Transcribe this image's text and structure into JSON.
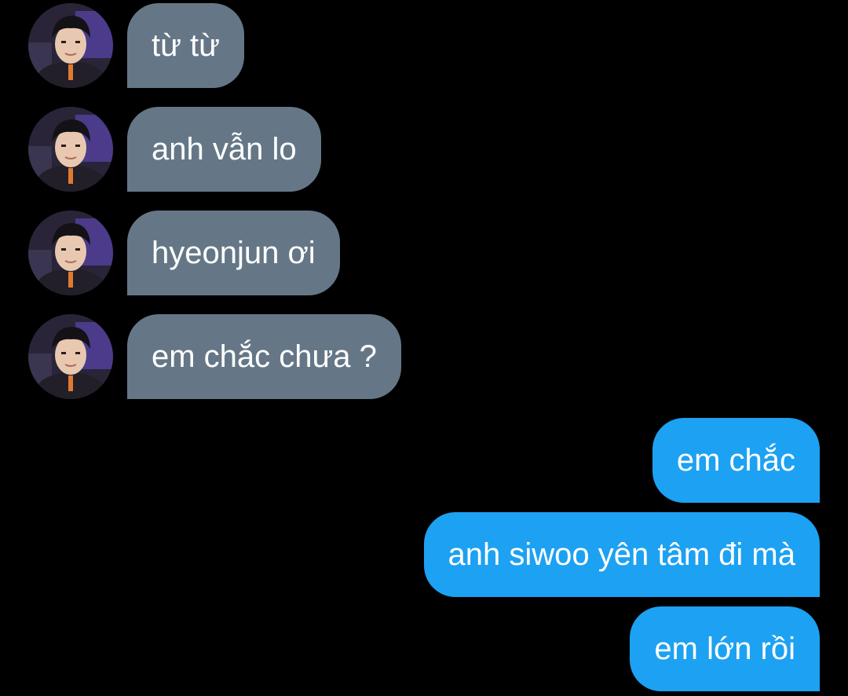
{
  "conversation": {
    "incoming": [
      {
        "text": "từ từ",
        "avatar": "contact-avatar"
      },
      {
        "text": "anh vẫn lo",
        "avatar": "contact-avatar"
      },
      {
        "text": "hyeonjun ơi",
        "avatar": "contact-avatar"
      },
      {
        "text": "em chắc chưa ?",
        "avatar": "contact-avatar"
      }
    ],
    "outgoing": [
      {
        "text": "em chắc"
      },
      {
        "text": "anh siwoo yên tâm đi mà"
      },
      {
        "text": "em lớn rồi"
      }
    ]
  },
  "colors": {
    "background": "#000000",
    "incoming_bubble": "#657786",
    "outgoing_bubble": "#1da1f2",
    "text": "#ffffff"
  }
}
